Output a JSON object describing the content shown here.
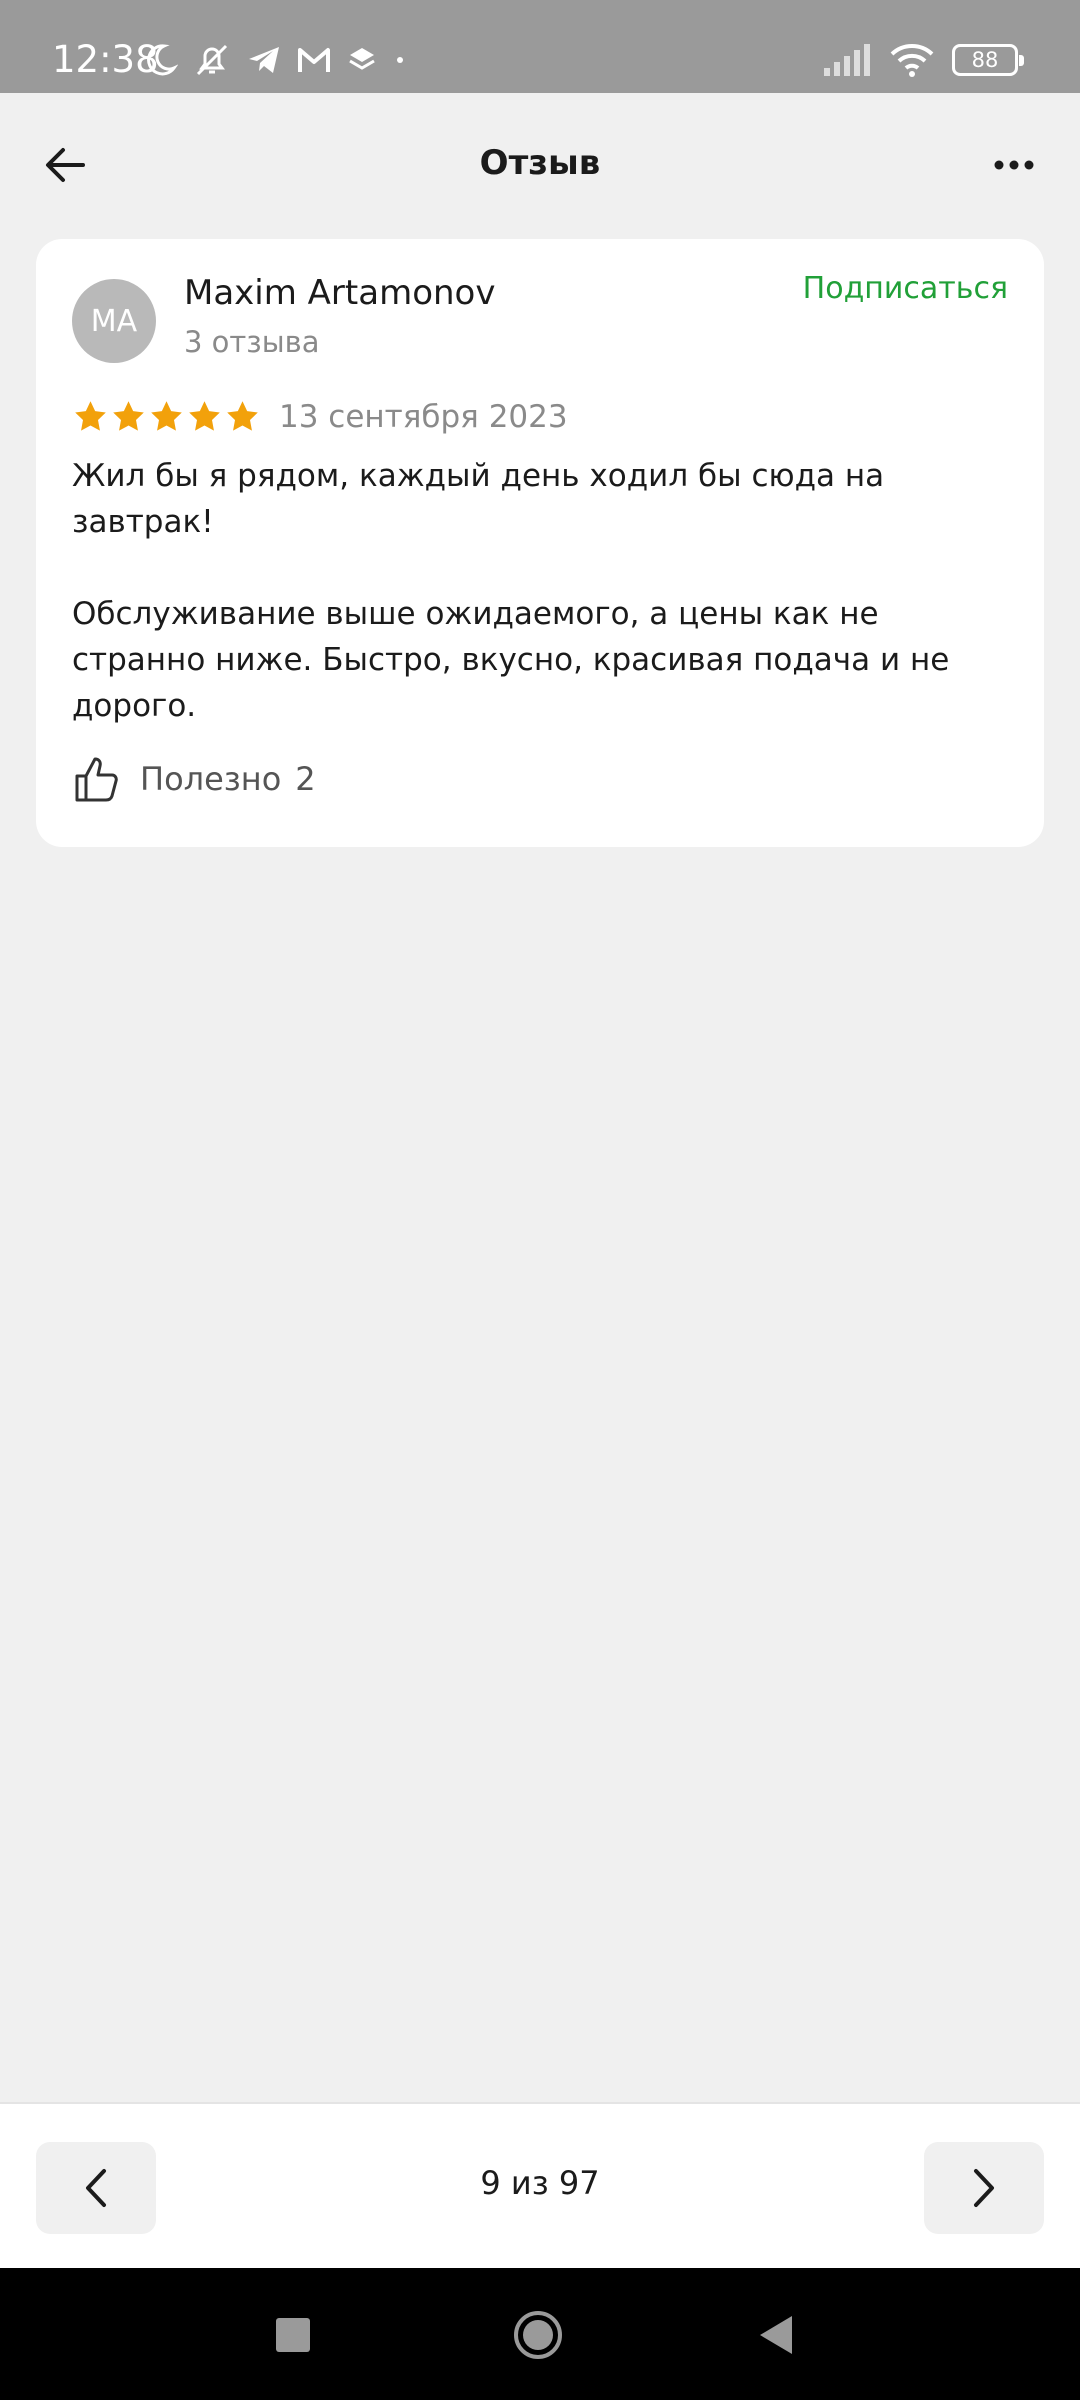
{
  "status_bar": {
    "time": "12:38",
    "battery": "88",
    "icons_left": [
      "moon-icon",
      "muted-bell-icon",
      "telegram-icon",
      "gmail-icon",
      "layers-icon",
      "dot-icon"
    ],
    "icons_right": [
      "signal-icon",
      "wifi-icon",
      "battery-icon"
    ]
  },
  "header": {
    "title": "Отзыв",
    "back_icon": "arrow-left-icon",
    "more_icon": "more-dots-icon"
  },
  "review": {
    "author_initials": "MA",
    "author_name": "Maxim Artamonov",
    "author_reviews": "3 отзыва",
    "subscribe_label": "Подписаться",
    "rating": 5,
    "rating_max": 5,
    "date": "13 сентября 2023",
    "text": "Жил бы я рядом, каждый день ходил бы сюда на завтрак!\n\nОбслуживание выше ожидаемого, а цены как не странно ниже. Быстро, вкусно, красивая подача и не дорого.",
    "useful_label": "Полезно",
    "useful_count": "2"
  },
  "pager": {
    "text": "9 из 97",
    "prev_icon": "chevron-left-icon",
    "next_icon": "chevron-right-icon"
  },
  "colors": {
    "accent_green": "#21a038",
    "star": "#f2a10b",
    "avatar_bg": "#b9b9b9",
    "background": "#f0f0f0"
  }
}
